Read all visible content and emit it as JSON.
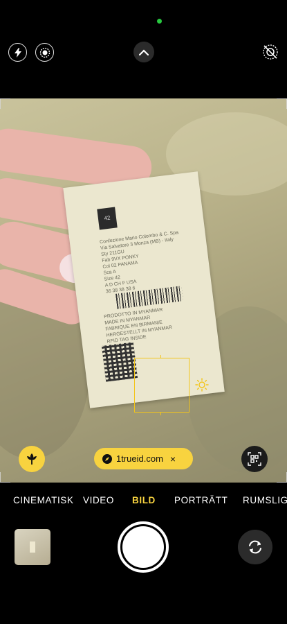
{
  "top": {
    "icons": [
      "flash-icon",
      "live-photo-icon",
      "chevron-up-icon",
      "live-off-icon"
    ]
  },
  "label": {
    "size_tag": "42",
    "lines": [
      "Confezione Mario Colombo & C. Spa",
      "Via Salvatore 3 Monza (MB) - Italy",
      "Sty  211GU",
      "Fab  9VX PONKY",
      "Col  02 PANAMA",
      "Sca  A",
      "Size 42",
      "A      D      CH     F    USA",
      "36    38     38     38     6"
    ],
    "made_in": [
      "PRODOTTO IN MYANMAR",
      "MADE IN MYANMAR",
      "FABRIQUE EN BIRMANIE",
      "HERGESTELLT IN MYANMAR",
      "RFID TAG INSIDE"
    ]
  },
  "overlay": {
    "link_text": "1trueid.com",
    "close_symbol": "×"
  },
  "modes": {
    "items": [
      "CINEMATISK",
      "VIDEO",
      "BILD",
      "PORTRÄTT",
      "RUMSLIG"
    ],
    "active": "BILD"
  },
  "colors": {
    "accent": "#f8d33f",
    "status_dot": "#28c840"
  }
}
